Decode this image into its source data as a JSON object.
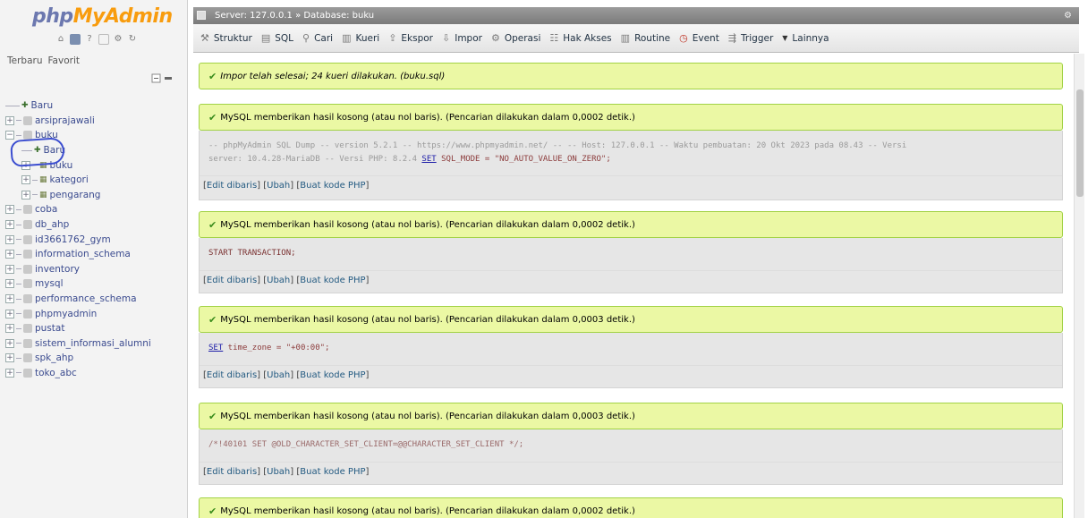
{
  "app": {
    "logo_php": "php",
    "logo_myadmin": "MyAdmin"
  },
  "sidebar": {
    "tabs": [
      "Terbaru",
      "Favorit"
    ],
    "tree": [
      {
        "label": "Baru",
        "indent": 0,
        "kind": "new"
      },
      {
        "label": "arsiprajawali",
        "indent": 0,
        "kind": "db"
      },
      {
        "label": "buku",
        "indent": 0,
        "kind": "db",
        "open": true
      },
      {
        "label": "Baru",
        "indent": 1,
        "kind": "new"
      },
      {
        "label": "buku",
        "indent": 1,
        "kind": "table"
      },
      {
        "label": "kategori",
        "indent": 1,
        "kind": "table"
      },
      {
        "label": "pengarang",
        "indent": 1,
        "kind": "table"
      },
      {
        "label": "coba",
        "indent": 0,
        "kind": "db"
      },
      {
        "label": "db_ahp",
        "indent": 0,
        "kind": "db"
      },
      {
        "label": "id3661762_gym",
        "indent": 0,
        "kind": "db"
      },
      {
        "label": "information_schema",
        "indent": 0,
        "kind": "db"
      },
      {
        "label": "inventory",
        "indent": 0,
        "kind": "db"
      },
      {
        "label": "mysql",
        "indent": 0,
        "kind": "db"
      },
      {
        "label": "performance_schema",
        "indent": 0,
        "kind": "db"
      },
      {
        "label": "phpmyadmin",
        "indent": 0,
        "kind": "db"
      },
      {
        "label": "pustat",
        "indent": 0,
        "kind": "db"
      },
      {
        "label": "sistem_informasi_alumni",
        "indent": 0,
        "kind": "db"
      },
      {
        "label": "spk_ahp",
        "indent": 0,
        "kind": "db"
      },
      {
        "label": "toko_abc",
        "indent": 0,
        "kind": "db"
      }
    ]
  },
  "topbar": {
    "server": "Server: 127.0.0.1",
    "sep": "»",
    "database": "Database: buku"
  },
  "tabs": [
    {
      "label": "Struktur",
      "icon": "structure-icon"
    },
    {
      "label": "SQL",
      "icon": "sql-icon"
    },
    {
      "label": "Cari",
      "icon": "search-icon"
    },
    {
      "label": "Kueri",
      "icon": "query-icon"
    },
    {
      "label": "Ekspor",
      "icon": "export-icon"
    },
    {
      "label": "Impor",
      "icon": "import-icon"
    },
    {
      "label": "Operasi",
      "icon": "wrench-icon"
    },
    {
      "label": "Hak Akses",
      "icon": "privileges-icon"
    },
    {
      "label": "Routine",
      "icon": "routine-icon"
    },
    {
      "label": "Event",
      "icon": "clock-icon"
    },
    {
      "label": "Trigger",
      "icon": "trigger-icon"
    },
    {
      "label": "Lainnya",
      "icon": "chevron-down-icon"
    }
  ],
  "import_notice": "Impor telah selesai; 24 kueri dilakukan. (buku.sql)",
  "results": [
    {
      "message": "MySQL memberikan hasil kosong (atau nol baris). (Pencarian dilakukan dalam 0,0002 detik.)",
      "sql_line1": "-- phpMyAdmin SQL Dump -- version 5.2.1 -- https://www.phpmyadmin.net/ -- -- Host: 127.0.0.1 -- Waktu pembuatan: 20 Okt 2023 pada 08.43 -- Versi",
      "sql_line2_pre": "server: 10.4.28-MariaDB -- Versi PHP: 8.2.4 ",
      "sql_line2_kw": "SET",
      "sql_line2_post": " SQL_MODE = \"NO_AUTO_VALUE_ON_ZERO\";"
    },
    {
      "message": "MySQL memberikan hasil kosong (atau nol baris). (Pencarian dilakukan dalam 0,0002 detik.)",
      "sql_line1": "START TRANSACTION;"
    },
    {
      "message": "MySQL memberikan hasil kosong (atau nol baris). (Pencarian dilakukan dalam 0,0003 detik.)",
      "sql_kw": "SET",
      "sql_rest": " time_zone = \"+00:00\";"
    },
    {
      "message": "MySQL memberikan hasil kosong (atau nol baris). (Pencarian dilakukan dalam 0,0003 detik.)",
      "sql_line1": "/*!40101 SET @OLD_CHARACTER_SET_CLIENT=@@CHARACTER_SET_CLIENT */;"
    },
    {
      "message": "MySQL memberikan hasil kosong (atau nol baris). (Pencarian dilakukan dalam 0,0002 detik.)"
    }
  ],
  "links": {
    "edit_inline": "Edit dibaris",
    "edit": "Ubah",
    "php": "Buat kode PHP"
  }
}
